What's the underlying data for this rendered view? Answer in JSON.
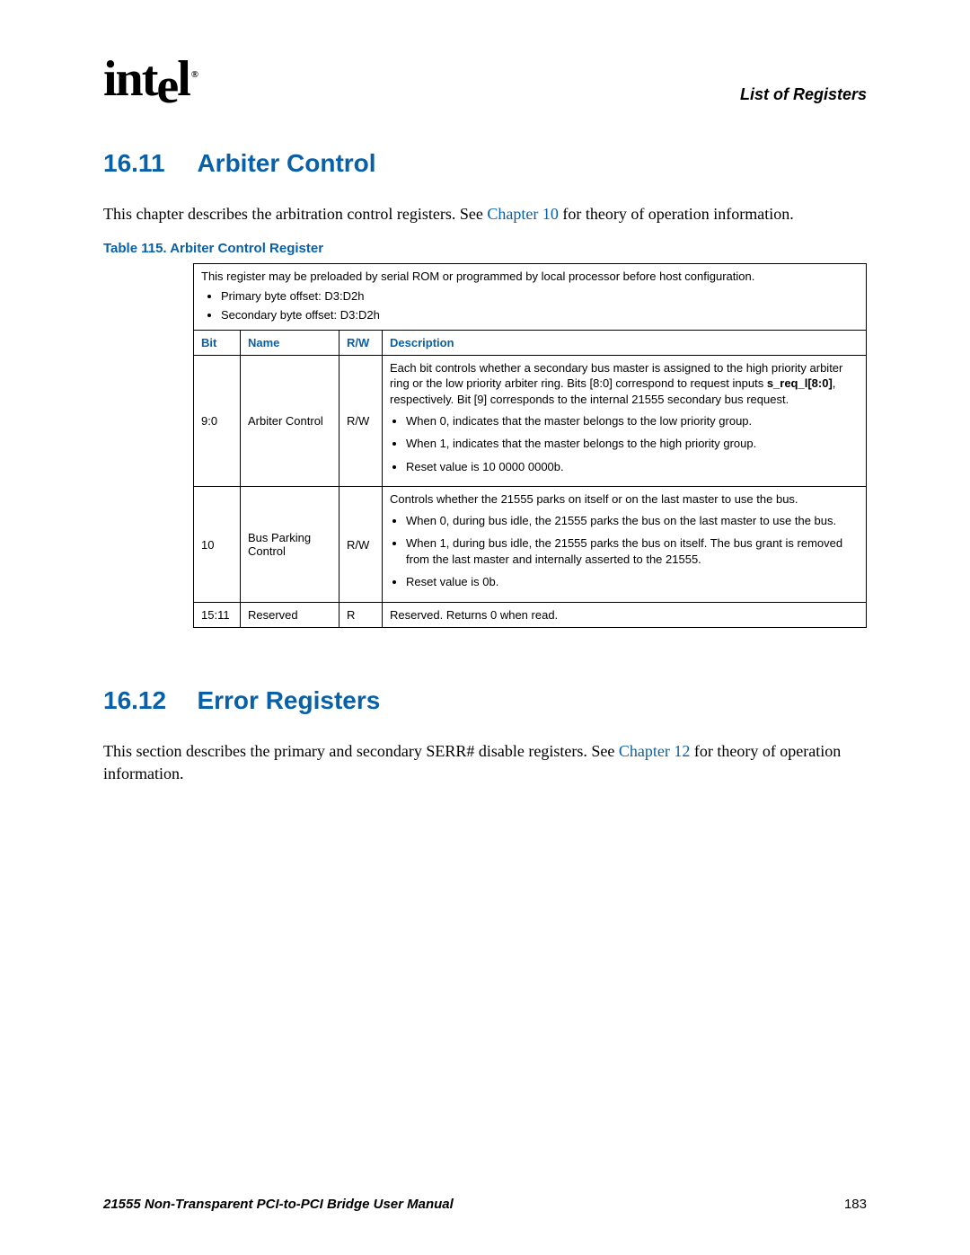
{
  "header": {
    "logo_text": "int",
    "logo_sub": "e",
    "logo_end": "l",
    "logo_reg": "®",
    "right": "List of Registers"
  },
  "section1": {
    "num": "16.11",
    "title": "Arbiter Control",
    "body_pre": "This chapter describes the arbitration control registers. See ",
    "body_link": "Chapter 10",
    "body_post": " for theory of operation information.",
    "table_caption": "Table 115. Arbiter Control Register",
    "intro_line": "This register may be preloaded by serial ROM or programmed by local processor before host configuration.",
    "intro_b1": "Primary byte offset: D3:D2h",
    "intro_b2": "Secondary byte offset: D3:D2h",
    "th_bit": "Bit",
    "th_name": "Name",
    "th_rw": "R/W",
    "th_desc": "Description",
    "row1": {
      "bit": "9:0",
      "name": "Arbiter Control",
      "rw": "R/W",
      "desc_p1_pre": "Each bit controls whether a secondary bus master is assigned to the high priority arbiter ring or the low priority arbiter ring. Bits [8:0] correspond to request inputs ",
      "desc_p1_bold": "s_req_l[8:0]",
      "desc_p1_post": ", respectively. Bit [9] corresponds to the internal 21555 secondary bus request.",
      "b1": "When 0, indicates that the master belongs to the low priority group.",
      "b2": "When 1, indicates that the master belongs to the high priority group.",
      "b3": "Reset value is 10 0000 0000b."
    },
    "row2": {
      "bit": "10",
      "name": "Bus Parking Control",
      "rw": "R/W",
      "desc_p1": "Controls whether the 21555 parks on itself or on the last master to use the bus.",
      "b1": "When 0, during bus idle, the 21555 parks the bus on the last master to use the bus.",
      "b2": "When 1, during bus idle, the 21555 parks the bus on itself. The bus grant is removed from the last master and internally asserted to the 21555.",
      "b3": "Reset value is 0b."
    },
    "row3": {
      "bit": "15:11",
      "name": "Reserved",
      "rw": "R",
      "desc": "Reserved. Returns 0 when read."
    }
  },
  "section2": {
    "num": "16.12",
    "title": "Error Registers",
    "body_pre": "This section describes the primary and secondary SERR# disable registers. See ",
    "body_link": "Chapter 12",
    "body_post": " for theory of operation information."
  },
  "footer": {
    "left": "21555 Non-Transparent PCI-to-PCI Bridge User Manual",
    "right": "183"
  }
}
